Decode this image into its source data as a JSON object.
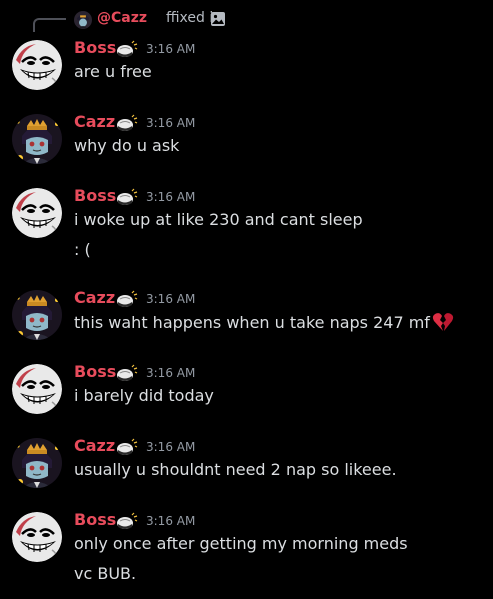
{
  "reply": {
    "author": "@Cazz",
    "text": "ffixed it",
    "attachment_icon": "image-icon"
  },
  "messages": [
    {
      "author": "Boss",
      "avatar": "troll-face-avatar",
      "badge": "rice-ball-icon",
      "time": "3:16 AM",
      "lines": [
        "are u free"
      ]
    },
    {
      "author": "Cazz",
      "avatar": "anime-character-avatar",
      "badge": "rice-ball-icon",
      "time": "3:16 AM",
      "lines": [
        "why do u ask"
      ]
    },
    {
      "author": "Boss",
      "avatar": "troll-face-avatar",
      "badge": "rice-ball-icon",
      "time": "3:16 AM",
      "lines": [
        "i woke up at like 230 and cant sleep",
        ": ("
      ]
    },
    {
      "author": "Cazz",
      "avatar": "anime-character-avatar",
      "badge": "rice-ball-icon",
      "time": "3:16 AM",
      "lines": [
        "this waht happens when u take naps 247 mf"
      ],
      "trailing_emoji": "broken-heart-icon"
    },
    {
      "author": "Boss",
      "avatar": "troll-face-avatar",
      "badge": "rice-ball-icon",
      "time": "3:16 AM",
      "lines": [
        "i barely did today"
      ]
    },
    {
      "author": "Cazz",
      "avatar": "anime-character-avatar",
      "badge": "rice-ball-icon",
      "time": "3:16 AM",
      "lines": [
        "usually u shouldnt need 2 nap so likeee."
      ]
    },
    {
      "author": "Boss",
      "avatar": "troll-face-avatar",
      "badge": "rice-ball-icon",
      "time": "3:16 AM",
      "lines": [
        "only once after getting my morning meds",
        "vc BUB."
      ]
    }
  ],
  "colors": {
    "background": "#000000",
    "username": "#e74c5c",
    "text": "#dbdee1",
    "timestamp": "#949ba4"
  }
}
